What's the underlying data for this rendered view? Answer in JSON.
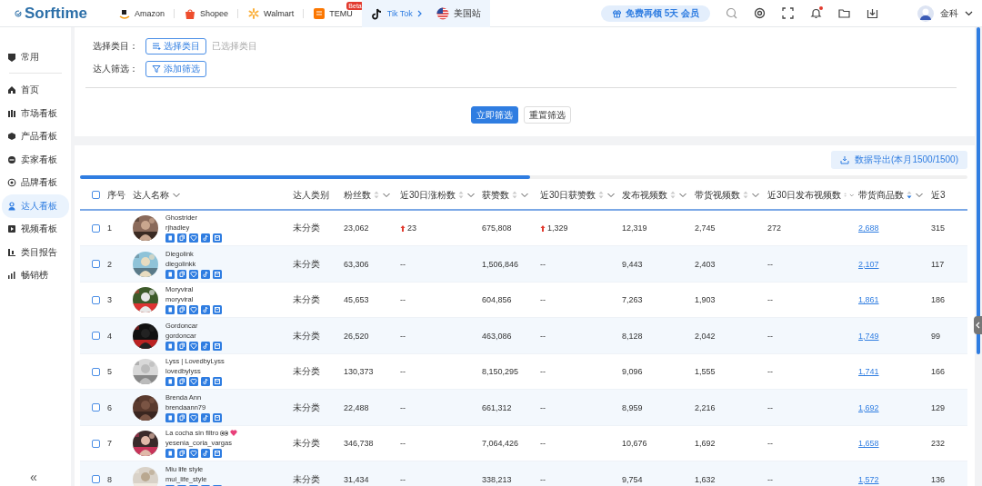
{
  "topbar": {
    "logo": "Sorftime",
    "platforms": [
      {
        "label": "Amazon",
        "selected": false
      },
      {
        "label": "Shopee",
        "selected": false
      },
      {
        "label": "Walmart",
        "selected": false
      },
      {
        "label": "TEMU",
        "selected": false,
        "badge": "Beta"
      },
      {
        "label": "Tik Tok",
        "selected": true
      }
    ],
    "region": "美国站",
    "promo": "免费再领 5天 会员",
    "notification_unread": true,
    "user": "金科"
  },
  "sidebar": {
    "items": [
      {
        "label": "常用",
        "selected": false
      },
      {
        "label": "首页",
        "selected": false
      },
      {
        "label": "市场看板",
        "selected": false
      },
      {
        "label": "产品看板",
        "selected": false
      },
      {
        "label": "卖家看板",
        "selected": false
      },
      {
        "label": "品牌看板",
        "selected": false
      },
      {
        "label": "达人看板",
        "selected": true
      },
      {
        "label": "视频看板",
        "selected": false
      },
      {
        "label": "类目报告",
        "selected": false
      },
      {
        "label": "畅销榜",
        "selected": false
      }
    ],
    "collapse": "«"
  },
  "filters": [
    {
      "label": "选择类目：",
      "button": "选择类目",
      "hint": "已选择类目"
    },
    {
      "label": "达人筛选：",
      "button": "添加筛选"
    }
  ],
  "actions": [
    {
      "label": "立即筛选",
      "kind": "primary"
    },
    {
      "label": "重置筛选",
      "kind": "default"
    }
  ],
  "export_button": "数据导出(本月1500/1500)",
  "table": {
    "all_selected": false,
    "columns": [
      {
        "label": "序号",
        "sortable": false,
        "menu": false
      },
      {
        "label": "达人名称",
        "sortable": false,
        "menu": true
      },
      {
        "label": "达人类别",
        "sortable": false,
        "menu": false
      },
      {
        "label": "粉丝数",
        "sortable": true,
        "sorted": false,
        "menu": true
      },
      {
        "label": "近30日涨粉数",
        "sortable": true,
        "sorted": false,
        "menu": true
      },
      {
        "label": "获赞数",
        "sortable": true,
        "sorted": false,
        "menu": true
      },
      {
        "label": "近30日获赞数",
        "sortable": true,
        "sorted": false,
        "menu": true
      },
      {
        "label": "发布视频数",
        "sortable": true,
        "sorted": false,
        "menu": true
      },
      {
        "label": "带货视频数",
        "sortable": true,
        "sorted": false,
        "menu": true
      },
      {
        "label": "近30日发布视频数",
        "sortable": true,
        "sorted": false,
        "menu": true
      },
      {
        "label": "带货商品数",
        "sortable": true,
        "sorted": true,
        "menu": true
      },
      {
        "label": "近3",
        "sortable": false,
        "menu": false
      }
    ],
    "rows": [
      {
        "selected": false,
        "index": "1",
        "name": "Ghostrider",
        "handle": "rjhadley",
        "emoji": false,
        "category": "未分类",
        "followers": "23,062",
        "followers_30d": {
          "text": "23",
          "rising": true
        },
        "likes": "675,808",
        "likes_30d": {
          "text": "1,329",
          "rising": true
        },
        "videos": "12,319",
        "sales_videos": "2,745",
        "videos_30d": "272",
        "products": "2,688",
        "column_13": "315"
      },
      {
        "selected": false,
        "index": "2",
        "name": "Diegolink",
        "handle": "diegolinkk",
        "emoji": false,
        "category": "未分类",
        "followers": "63,306",
        "followers_30d": {
          "text": "--",
          "rising": false
        },
        "likes": "1,506,846",
        "likes_30d": {
          "text": "--",
          "rising": false
        },
        "videos": "9,443",
        "sales_videos": "2,403",
        "videos_30d": "--",
        "products": "2,107",
        "column_13": "117"
      },
      {
        "selected": false,
        "index": "3",
        "name": "Moryviral",
        "handle": "moryviral",
        "emoji": false,
        "category": "未分类",
        "followers": "45,653",
        "followers_30d": {
          "text": "--",
          "rising": false
        },
        "likes": "604,856",
        "likes_30d": {
          "text": "--",
          "rising": false
        },
        "videos": "7,263",
        "sales_videos": "1,903",
        "videos_30d": "--",
        "products": "1,861",
        "column_13": "186"
      },
      {
        "selected": false,
        "index": "4",
        "name": "Gordoncar",
        "handle": "gordoncar",
        "emoji": false,
        "category": "未分类",
        "followers": "26,520",
        "followers_30d": {
          "text": "--",
          "rising": false
        },
        "likes": "463,086",
        "likes_30d": {
          "text": "--",
          "rising": false
        },
        "videos": "8,128",
        "sales_videos": "2,042",
        "videos_30d": "--",
        "products": "1,749",
        "column_13": "99"
      },
      {
        "selected": false,
        "index": "5",
        "name": "Lyss | LovedbyLyss",
        "handle": "lovedbylyss",
        "emoji": false,
        "category": "未分类",
        "followers": "130,373",
        "followers_30d": {
          "text": "--",
          "rising": false
        },
        "likes": "8,150,295",
        "likes_30d": {
          "text": "--",
          "rising": false
        },
        "videos": "9,096",
        "sales_videos": "1,555",
        "videos_30d": "--",
        "products": "1,741",
        "column_13": "166"
      },
      {
        "selected": false,
        "index": "6",
        "name": "Brenda Ann",
        "handle": "brendaann79",
        "emoji": false,
        "category": "未分类",
        "followers": "22,488",
        "followers_30d": {
          "text": "--",
          "rising": false
        },
        "likes": "661,312",
        "likes_30d": {
          "text": "--",
          "rising": false
        },
        "videos": "8,959",
        "sales_videos": "2,216",
        "videos_30d": "--",
        "products": "1,692",
        "column_13": "129"
      },
      {
        "selected": false,
        "index": "7",
        "name": "La cocha sin filtro",
        "handle": "yesenia_coria_vargas",
        "emoji": true,
        "category": "未分类",
        "followers": "346,738",
        "followers_30d": {
          "text": "--",
          "rising": false
        },
        "likes": "7,064,426",
        "likes_30d": {
          "text": "--",
          "rising": false
        },
        "videos": "10,676",
        "sales_videos": "1,692",
        "videos_30d": "--",
        "products": "1,658",
        "column_13": "232"
      },
      {
        "selected": false,
        "index": "8",
        "name": "Miu life style",
        "handle": "mui_life_style",
        "emoji": false,
        "category": "未分类",
        "followers": "31,434",
        "followers_30d": {
          "text": "--",
          "rising": false
        },
        "likes": "338,213",
        "likes_30d": {
          "text": "--",
          "rising": false
        },
        "videos": "9,754",
        "sales_videos": "1,632",
        "videos_30d": "--",
        "products": "1,572",
        "column_13": "136"
      }
    ]
  }
}
